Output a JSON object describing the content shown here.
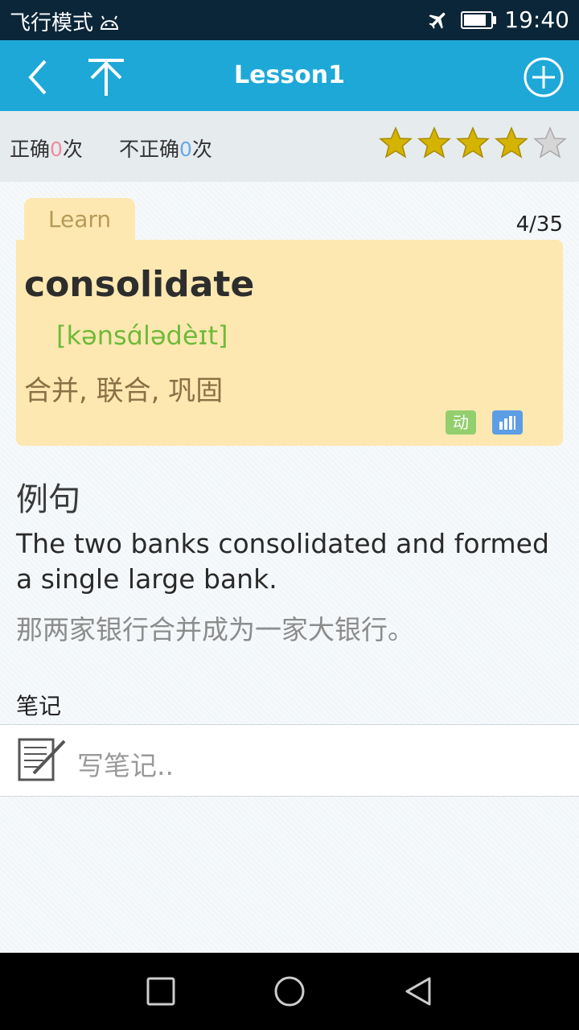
{
  "status_bar": {
    "mode_text": "飞行模式",
    "time": "19:40",
    "battery_level": 0.85
  },
  "app_bar": {
    "title": "Lesson1"
  },
  "stats": {
    "correct_label": "正确",
    "correct_count": "0",
    "correct_unit": "次",
    "incorrect_label": "不正确",
    "incorrect_count": "0",
    "incorrect_unit": "次",
    "rating": 4,
    "rating_max": 5
  },
  "card": {
    "tab_label": "Learn",
    "counter": "4/35",
    "word": "consolidate",
    "phonetic": "[kənsɑ́lədèɪt]",
    "meaning": "合并, 联合, 巩固",
    "pos_tag": "动"
  },
  "example": {
    "title": "例句",
    "english": "The two banks consolidated and formed a single large bank.",
    "chinese": "那两家银行合并成为一家大银行。"
  },
  "notes": {
    "label": "笔记",
    "placeholder": "写笔记.."
  },
  "colors": {
    "accent": "#1ea8d8",
    "card": "#fde8b1",
    "correct": "#f08ca0",
    "incorrect": "#6aa8e8",
    "star": "#d4b400"
  }
}
